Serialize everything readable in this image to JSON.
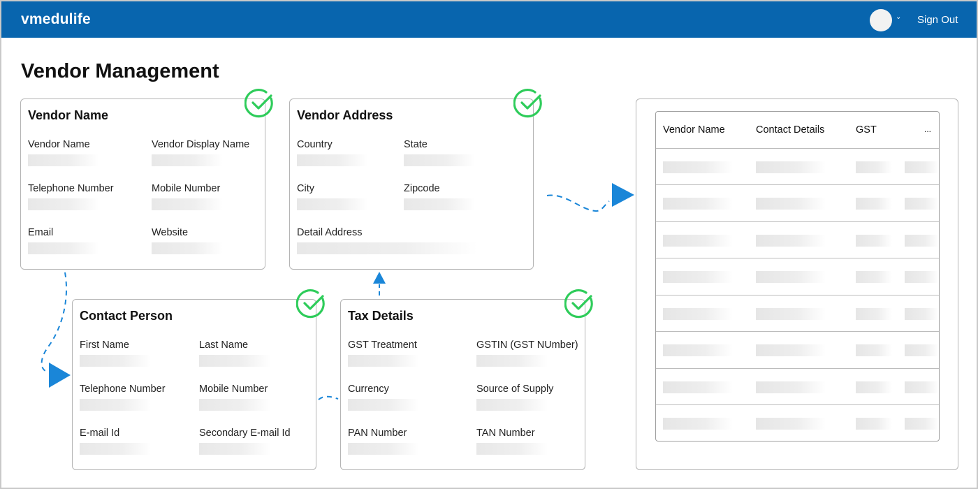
{
  "header": {
    "brand": "vmedulife",
    "sign_out": "Sign Out"
  },
  "page_title": "Vendor Management",
  "cards": {
    "vendor_name": {
      "title": "Vendor Name",
      "fields": [
        "Vendor Name",
        "Vendor Display Name",
        "Telephone Number",
        "Mobile Number",
        "Email",
        "Website"
      ]
    },
    "vendor_address": {
      "title": "Vendor Address",
      "fields": [
        "Country",
        "State",
        "City",
        "Zipcode",
        "Detail Address"
      ]
    },
    "contact_person": {
      "title": "Contact Person",
      "fields": [
        "First Name",
        "Last Name",
        "Telephone Number",
        "Mobile Number",
        "E-mail Id",
        "Secondary E-mail Id"
      ]
    },
    "tax_details": {
      "title": "Tax Details",
      "fields": [
        "GST Treatment",
        "GSTIN (GST NUmber)",
        "Currency",
        "Source of Supply",
        "PAN Number",
        "TAN Number"
      ]
    }
  },
  "table": {
    "columns": [
      "Vendor Name",
      "Contact Details",
      "GST",
      "..."
    ]
  },
  "colors": {
    "header_bg": "#0865ae",
    "check_green": "#2ecc5a",
    "arrow_blue": "#1a86d8"
  },
  "icons": {
    "check": "check-circle-icon",
    "avatar": "avatar",
    "caret": "chevron-down-icon"
  }
}
